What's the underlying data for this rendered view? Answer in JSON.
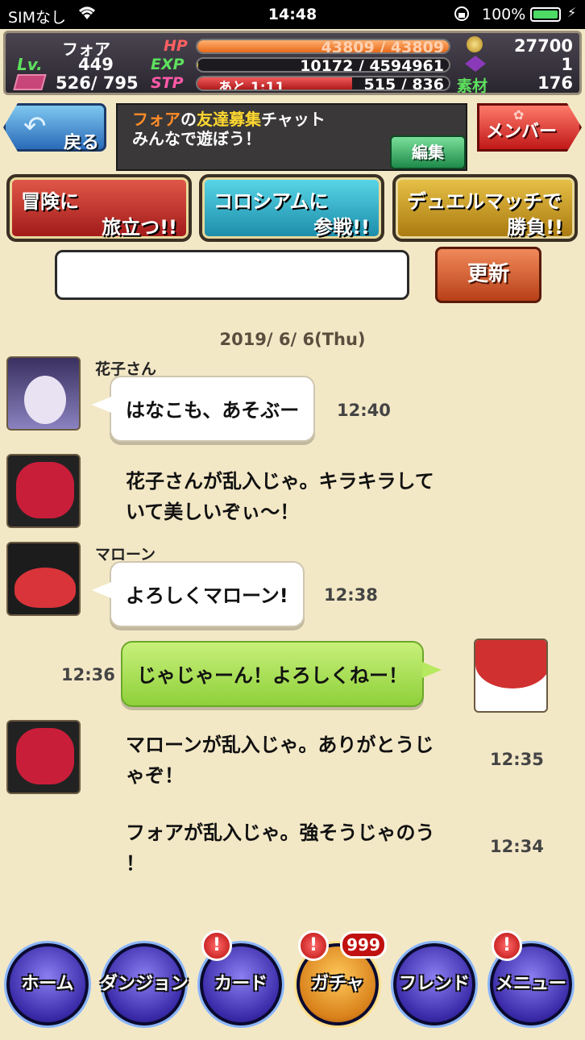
{
  "status_bar": {
    "carrier": "SIMなし",
    "time": "14:48",
    "battery_pct_text": "100%",
    "battery_level": 1.0
  },
  "stats": {
    "name": "フォア",
    "lv_label": "Lv.",
    "level": "449",
    "stamina": "526/ 795",
    "hp_label": "HP",
    "hp_text": "43809 / 43809",
    "hp_fraction": 1.0,
    "exp_label": "EXP",
    "exp_text": "10172 / 4594961",
    "exp_fraction": 0.002,
    "stp_label": "STP",
    "stp_timer": "あと 1:11",
    "stp_text": "515 / 836",
    "stp_fraction": 0.616,
    "coins": "27700",
    "tickets": "1",
    "sozai_label": "素材",
    "sozai": "176"
  },
  "header": {
    "back_label": "戻る",
    "chat_owner": "フォア",
    "title_no": "の",
    "title_highlight": "友達募集",
    "title_rest": "チャット",
    "subtitle": "みんなで遊ぼう！",
    "edit_label": "編集",
    "member_label": "メンバー"
  },
  "actions": {
    "adventure_l1": "冒険に",
    "adventure_l2": "旅立つ!!",
    "colosseum_l1": "コロシアムに",
    "colosseum_l2": "参戦!!",
    "duel_l1": "デュエルマッチで",
    "duel_l2": "勝負!!"
  },
  "input": {
    "value": "",
    "refresh_label": "更新"
  },
  "chat": {
    "date": "2019/ 6/ 6(Thu)",
    "messages": [
      {
        "sender": "花子さん",
        "text": "はなこも、あそぶー",
        "time": "12:40"
      },
      {
        "text_l1": "花子さんが乱入じゃ。キラキラして",
        "text_l2": "いて美しいぞぃ～！"
      },
      {
        "sender": "マローン",
        "text": "よろしくマローン!",
        "time": "12:38"
      },
      {
        "text": "じゃじゃーん！よろしくねー！",
        "time": "12:36"
      },
      {
        "text_l1": "マローンが乱入じゃ。ありがとうじ",
        "text_l2": "ゃぞ！",
        "time": "12:35"
      },
      {
        "text_l1": "フォアが乱入じゃ。強そうじゃのう",
        "text_l2": "！",
        "time": "12:34"
      }
    ]
  },
  "nav": {
    "home": "ホーム",
    "dungeon": "ダンジョン",
    "card": "カード",
    "gacha": "ガチャ",
    "friend": "フレンド",
    "menu": "メニュー",
    "alert_mark": "!",
    "gacha_badge": "999"
  }
}
